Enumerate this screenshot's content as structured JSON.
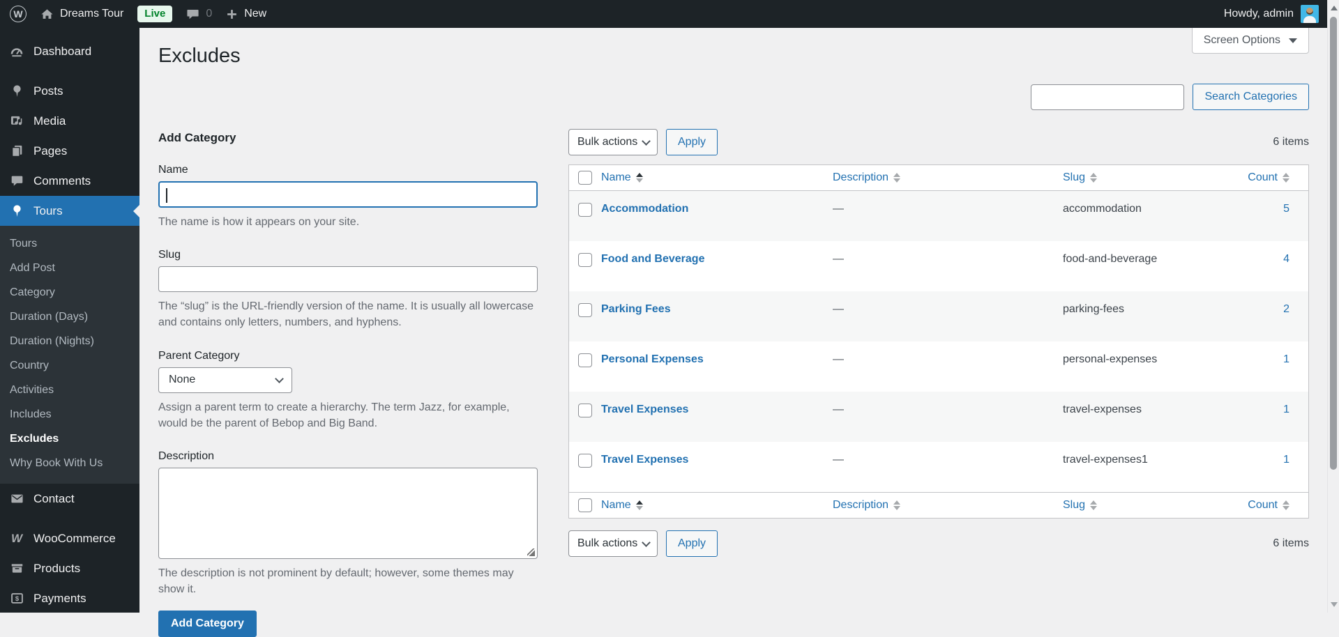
{
  "admin_bar": {
    "site_name": "Dreams Tour",
    "live_badge": "Live",
    "comment_count": "0",
    "new_label": "New",
    "howdy": "Howdy, admin"
  },
  "sidebar": {
    "items": [
      {
        "label": "Dashboard",
        "icon": "dashboard-icon"
      },
      {
        "label": "Posts",
        "icon": "pin-icon"
      },
      {
        "label": "Media",
        "icon": "media-icon"
      },
      {
        "label": "Pages",
        "icon": "pages-icon"
      },
      {
        "label": "Comments",
        "icon": "comment-icon"
      },
      {
        "label": "Tours",
        "icon": "pin-icon",
        "active": true
      },
      {
        "label": "Contact",
        "icon": "envelope-icon"
      },
      {
        "label": "WooCommerce",
        "icon": "woocommerce-icon"
      },
      {
        "label": "Products",
        "icon": "box-icon"
      },
      {
        "label": "Payments",
        "icon": "dollar-icon"
      }
    ],
    "submenu": [
      "Tours",
      "Add Post",
      "Category",
      "Duration (Days)",
      "Duration (Nights)",
      "Country",
      "Activities",
      "Includes",
      "Excludes",
      "Why Book With Us"
    ],
    "current_submenu": "Excludes"
  },
  "page": {
    "title": "Excludes",
    "screen_options_label": "Screen Options"
  },
  "search": {
    "input_value": "",
    "button_label": "Search Categories"
  },
  "form": {
    "heading": "Add Category",
    "name_label": "Name",
    "name_value": "",
    "name_help": "The name is how it appears on your site.",
    "slug_label": "Slug",
    "slug_value": "",
    "slug_help": "The “slug” is the URL-friendly version of the name. It is usually all lowercase and contains only letters, numbers, and hyphens.",
    "parent_label": "Parent Category",
    "parent_value": "None",
    "parent_help": "Assign a parent term to create a hierarchy. The term Jazz, for example, would be the parent of Bebop and Big Band.",
    "description_label": "Description",
    "description_value": "",
    "description_help": "The description is not prominent by default; however, some themes may show it.",
    "submit_label": "Add Category"
  },
  "list": {
    "bulk_actions_label": "Bulk actions",
    "apply_label": "Apply",
    "items_count": "6 items",
    "columns": [
      "Name",
      "Description",
      "Slug",
      "Count"
    ],
    "sorted_column": "Name",
    "rows": [
      {
        "name": "Accommodation",
        "description": "—",
        "slug": "accommodation",
        "count": "5"
      },
      {
        "name": "Food and Beverage",
        "description": "—",
        "slug": "food-and-beverage",
        "count": "4"
      },
      {
        "name": "Parking Fees",
        "description": "—",
        "slug": "parking-fees",
        "count": "2"
      },
      {
        "name": "Personal Expenses",
        "description": "—",
        "slug": "personal-expenses",
        "count": "1"
      },
      {
        "name": "Travel Expenses",
        "description": "—",
        "slug": "travel-expenses",
        "count": "1"
      },
      {
        "name": "Travel Expenses",
        "description": "—",
        "slug": "travel-expenses1",
        "count": "1"
      }
    ]
  },
  "colors": {
    "accent": "#2271b1",
    "admin_bar_bg": "#1d2327",
    "submenu_bg": "#2c3338",
    "content_bg": "#f0f0f1",
    "live_badge_bg": "#e7f7ed",
    "live_badge_text": "#00832a",
    "stripe_row_bg": "#f6f7f7"
  }
}
